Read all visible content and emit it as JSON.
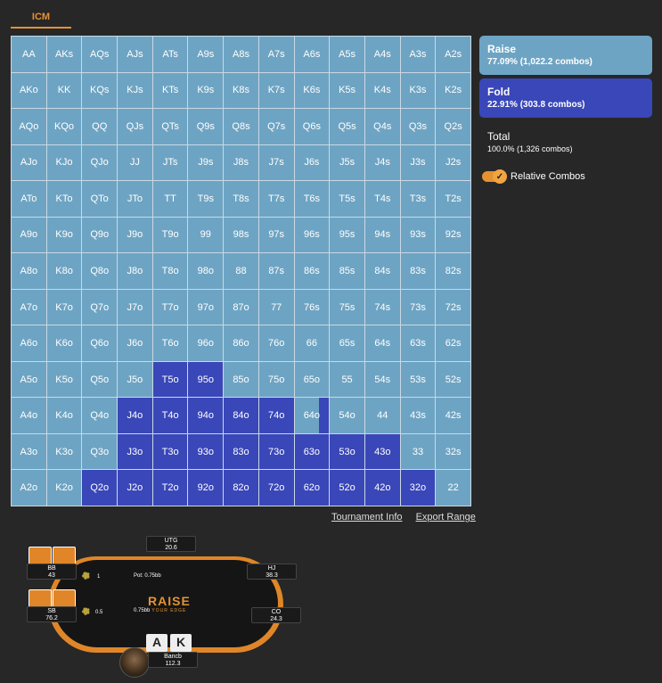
{
  "tabs": [
    {
      "label": "ICM"
    }
  ],
  "grid": [
    {
      "label": "AA",
      "fold": 0
    },
    {
      "label": "AKs",
      "fold": 0
    },
    {
      "label": "AQs",
      "fold": 0
    },
    {
      "label": "AJs",
      "fold": 0
    },
    {
      "label": "ATs",
      "fold": 0
    },
    {
      "label": "A9s",
      "fold": 0
    },
    {
      "label": "A8s",
      "fold": 0
    },
    {
      "label": "A7s",
      "fold": 0
    },
    {
      "label": "A6s",
      "fold": 0
    },
    {
      "label": "A5s",
      "fold": 0
    },
    {
      "label": "A4s",
      "fold": 0
    },
    {
      "label": "A3s",
      "fold": 0
    },
    {
      "label": "A2s",
      "fold": 0
    },
    {
      "label": "AKo",
      "fold": 0
    },
    {
      "label": "KK",
      "fold": 0
    },
    {
      "label": "KQs",
      "fold": 0
    },
    {
      "label": "KJs",
      "fold": 0
    },
    {
      "label": "KTs",
      "fold": 0
    },
    {
      "label": "K9s",
      "fold": 0
    },
    {
      "label": "K8s",
      "fold": 0
    },
    {
      "label": "K7s",
      "fold": 0
    },
    {
      "label": "K6s",
      "fold": 0
    },
    {
      "label": "K5s",
      "fold": 0
    },
    {
      "label": "K4s",
      "fold": 0
    },
    {
      "label": "K3s",
      "fold": 0
    },
    {
      "label": "K2s",
      "fold": 0
    },
    {
      "label": "AQo",
      "fold": 0
    },
    {
      "label": "KQo",
      "fold": 0
    },
    {
      "label": "QQ",
      "fold": 0
    },
    {
      "label": "QJs",
      "fold": 0
    },
    {
      "label": "QTs",
      "fold": 0
    },
    {
      "label": "Q9s",
      "fold": 0
    },
    {
      "label": "Q8s",
      "fold": 0
    },
    {
      "label": "Q7s",
      "fold": 0
    },
    {
      "label": "Q6s",
      "fold": 0
    },
    {
      "label": "Q5s",
      "fold": 0
    },
    {
      "label": "Q4s",
      "fold": 0
    },
    {
      "label": "Q3s",
      "fold": 0
    },
    {
      "label": "Q2s",
      "fold": 0
    },
    {
      "label": "AJo",
      "fold": 0
    },
    {
      "label": "KJo",
      "fold": 0
    },
    {
      "label": "QJo",
      "fold": 0
    },
    {
      "label": "JJ",
      "fold": 0
    },
    {
      "label": "JTs",
      "fold": 0
    },
    {
      "label": "J9s",
      "fold": 0
    },
    {
      "label": "J8s",
      "fold": 0
    },
    {
      "label": "J7s",
      "fold": 0
    },
    {
      "label": "J6s",
      "fold": 0
    },
    {
      "label": "J5s",
      "fold": 0
    },
    {
      "label": "J4s",
      "fold": 0
    },
    {
      "label": "J3s",
      "fold": 0
    },
    {
      "label": "J2s",
      "fold": 0
    },
    {
      "label": "ATo",
      "fold": 0
    },
    {
      "label": "KTo",
      "fold": 0
    },
    {
      "label": "QTo",
      "fold": 0
    },
    {
      "label": "JTo",
      "fold": 0
    },
    {
      "label": "TT",
      "fold": 0
    },
    {
      "label": "T9s",
      "fold": 0
    },
    {
      "label": "T8s",
      "fold": 0
    },
    {
      "label": "T7s",
      "fold": 0
    },
    {
      "label": "T6s",
      "fold": 0
    },
    {
      "label": "T5s",
      "fold": 0
    },
    {
      "label": "T4s",
      "fold": 0
    },
    {
      "label": "T3s",
      "fold": 0
    },
    {
      "label": "T2s",
      "fold": 0
    },
    {
      "label": "A9o",
      "fold": 0
    },
    {
      "label": "K9o",
      "fold": 0
    },
    {
      "label": "Q9o",
      "fold": 0
    },
    {
      "label": "J9o",
      "fold": 0
    },
    {
      "label": "T9o",
      "fold": 0
    },
    {
      "label": "99",
      "fold": 0
    },
    {
      "label": "98s",
      "fold": 0
    },
    {
      "label": "97s",
      "fold": 0
    },
    {
      "label": "96s",
      "fold": 0
    },
    {
      "label": "95s",
      "fold": 0
    },
    {
      "label": "94s",
      "fold": 0
    },
    {
      "label": "93s",
      "fold": 0
    },
    {
      "label": "92s",
      "fold": 0
    },
    {
      "label": "A8o",
      "fold": 0
    },
    {
      "label": "K8o",
      "fold": 0
    },
    {
      "label": "Q8o",
      "fold": 0
    },
    {
      "label": "J8o",
      "fold": 0
    },
    {
      "label": "T8o",
      "fold": 0
    },
    {
      "label": "98o",
      "fold": 0
    },
    {
      "label": "88",
      "fold": 0
    },
    {
      "label": "87s",
      "fold": 0
    },
    {
      "label": "86s",
      "fold": 0
    },
    {
      "label": "85s",
      "fold": 0
    },
    {
      "label": "84s",
      "fold": 0
    },
    {
      "label": "83s",
      "fold": 0
    },
    {
      "label": "82s",
      "fold": 0
    },
    {
      "label": "A7o",
      "fold": 0
    },
    {
      "label": "K7o",
      "fold": 0
    },
    {
      "label": "Q7o",
      "fold": 0
    },
    {
      "label": "J7o",
      "fold": 0
    },
    {
      "label": "T7o",
      "fold": 0
    },
    {
      "label": "97o",
      "fold": 0
    },
    {
      "label": "87o",
      "fold": 0
    },
    {
      "label": "77",
      "fold": 0
    },
    {
      "label": "76s",
      "fold": 0
    },
    {
      "label": "75s",
      "fold": 0
    },
    {
      "label": "74s",
      "fold": 0
    },
    {
      "label": "73s",
      "fold": 0
    },
    {
      "label": "72s",
      "fold": 0
    },
    {
      "label": "A6o",
      "fold": 0
    },
    {
      "label": "K6o",
      "fold": 0
    },
    {
      "label": "Q6o",
      "fold": 0
    },
    {
      "label": "J6o",
      "fold": 0
    },
    {
      "label": "T6o",
      "fold": 0
    },
    {
      "label": "96o",
      "fold": 0
    },
    {
      "label": "86o",
      "fold": 0
    },
    {
      "label": "76o",
      "fold": 0
    },
    {
      "label": "66",
      "fold": 0
    },
    {
      "label": "65s",
      "fold": 0
    },
    {
      "label": "64s",
      "fold": 0
    },
    {
      "label": "63s",
      "fold": 0
    },
    {
      "label": "62s",
      "fold": 0
    },
    {
      "label": "A5o",
      "fold": 0
    },
    {
      "label": "K5o",
      "fold": 0
    },
    {
      "label": "Q5o",
      "fold": 0
    },
    {
      "label": "J5o",
      "fold": 0
    },
    {
      "label": "T5o",
      "fold": 1
    },
    {
      "label": "95o",
      "fold": 1
    },
    {
      "label": "85o",
      "fold": 0
    },
    {
      "label": "75o",
      "fold": 0
    },
    {
      "label": "65o",
      "fold": 0
    },
    {
      "label": "55",
      "fold": 0
    },
    {
      "label": "54s",
      "fold": 0
    },
    {
      "label": "53s",
      "fold": 0
    },
    {
      "label": "52s",
      "fold": 0
    },
    {
      "label": "A4o",
      "fold": 0
    },
    {
      "label": "K4o",
      "fold": 0
    },
    {
      "label": "Q4o",
      "fold": 0
    },
    {
      "label": "J4o",
      "fold": 1
    },
    {
      "label": "T4o",
      "fold": 1
    },
    {
      "label": "94o",
      "fold": 1
    },
    {
      "label": "84o",
      "fold": 1
    },
    {
      "label": "74o",
      "fold": 1
    },
    {
      "label": "64o",
      "fold": 0.3
    },
    {
      "label": "54o",
      "fold": 0
    },
    {
      "label": "44",
      "fold": 0
    },
    {
      "label": "43s",
      "fold": 0
    },
    {
      "label": "42s",
      "fold": 0
    },
    {
      "label": "A3o",
      "fold": 0
    },
    {
      "label": "K3o",
      "fold": 0
    },
    {
      "label": "Q3o",
      "fold": 0
    },
    {
      "label": "J3o",
      "fold": 1
    },
    {
      "label": "T3o",
      "fold": 1
    },
    {
      "label": "93o",
      "fold": 1
    },
    {
      "label": "83o",
      "fold": 1
    },
    {
      "label": "73o",
      "fold": 1
    },
    {
      "label": "63o",
      "fold": 1
    },
    {
      "label": "53o",
      "fold": 1
    },
    {
      "label": "43o",
      "fold": 1
    },
    {
      "label": "33",
      "fold": 0
    },
    {
      "label": "32s",
      "fold": 0
    },
    {
      "label": "A2o",
      "fold": 0
    },
    {
      "label": "K2o",
      "fold": 0
    },
    {
      "label": "Q2o",
      "fold": 1
    },
    {
      "label": "J2o",
      "fold": 1
    },
    {
      "label": "T2o",
      "fold": 1
    },
    {
      "label": "92o",
      "fold": 1
    },
    {
      "label": "82o",
      "fold": 1
    },
    {
      "label": "72o",
      "fold": 1
    },
    {
      "label": "62o",
      "fold": 1
    },
    {
      "label": "52o",
      "fold": 1
    },
    {
      "label": "42o",
      "fold": 1
    },
    {
      "label": "32o",
      "fold": 1
    },
    {
      "label": "22",
      "fold": 0
    }
  ],
  "colors": {
    "raise": "#6ea4c3",
    "fold": "#3a47b8",
    "accent": "#e59232"
  },
  "links": {
    "tournament_info": "Tournament Info",
    "export_range": "Export Range"
  },
  "summary": {
    "raise": {
      "title": "Raise",
      "detail": "77.09% (1,022.2 combos)"
    },
    "fold": {
      "title": "Fold",
      "detail": "22.91% (303.8 combos)"
    },
    "total": {
      "title": "Total",
      "detail": "100.0% (1,326 combos)"
    }
  },
  "relative_combos": {
    "label": "Relative Combos",
    "checked": true
  },
  "table": {
    "logo_main": "RAISE",
    "logo_sub": "YOUR EDGE",
    "pot_label": "Pot: 0.75bb",
    "bet_bb": "1",
    "bet_sb": "0.5",
    "center_amount": "0.75bb",
    "seats": {
      "utg": {
        "name": "UTG",
        "stack": "20.6"
      },
      "hj": {
        "name": "HJ",
        "stack": "38.3"
      },
      "co": {
        "name": "CO",
        "stack": "24.3"
      },
      "bb": {
        "name": "BB",
        "stack": "43"
      },
      "sb": {
        "name": "SB",
        "stack": "76.2"
      },
      "hero": {
        "name": "Bancb",
        "stack": "112.3"
      }
    },
    "hero_cards": [
      "A",
      "K"
    ]
  }
}
